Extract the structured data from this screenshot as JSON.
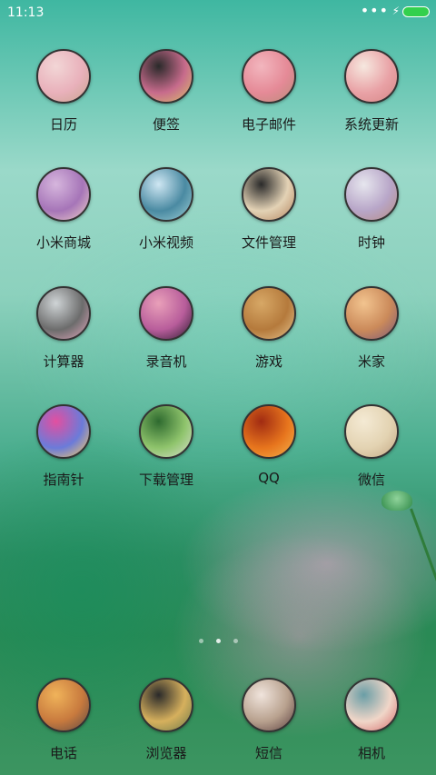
{
  "status_bar": {
    "time": "11:13",
    "dots": "•••",
    "charging_icon": "lightning-icon",
    "battery_color": "#33d04d"
  },
  "apps": [
    {
      "label": "日历",
      "icon": "calendar-icon",
      "colors": [
        "#f2d6d6",
        "#e9b1bb",
        "#c9a48f"
      ]
    },
    {
      "label": "便签",
      "icon": "notes-icon",
      "colors": [
        "#2a2a2a",
        "#c76b8c",
        "#d9c26a"
      ]
    },
    {
      "label": "电子邮件",
      "icon": "mail-icon",
      "colors": [
        "#f2b6be",
        "#e58a97",
        "#b98c7a"
      ]
    },
    {
      "label": "系统更新",
      "icon": "update-icon",
      "colors": [
        "#f6e8df",
        "#e9a2a6",
        "#d68686"
      ]
    },
    {
      "label": "小米商城",
      "icon": "mi-store-icon",
      "colors": [
        "#d6b6dd",
        "#a675b8",
        "#f1d1c8"
      ]
    },
    {
      "label": "小米视频",
      "icon": "mi-video-icon",
      "colors": [
        "#cfe7f3",
        "#4a8aa2",
        "#9fd0d6"
      ]
    },
    {
      "label": "文件管理",
      "icon": "file-manager-icon",
      "colors": [
        "#2a2a2a",
        "#e3d2b5",
        "#b3845e"
      ]
    },
    {
      "label": "时钟",
      "icon": "clock-icon",
      "colors": [
        "#e6e6ee",
        "#b8a6c8",
        "#b98d83"
      ]
    },
    {
      "label": "计算器",
      "icon": "calculator-icon",
      "colors": [
        "#cfd4d6",
        "#6c6c6c",
        "#e6a9c0"
      ]
    },
    {
      "label": "录音机",
      "icon": "recorder-icon",
      "colors": [
        "#e9a0b9",
        "#b85d9b",
        "#2b1b2f"
      ]
    },
    {
      "label": "游戏",
      "icon": "game-icon",
      "colors": [
        "#d7a866",
        "#b57a3c",
        "#e5c48e"
      ]
    },
    {
      "label": "米家",
      "icon": "mijia-icon",
      "colors": [
        "#f2c48f",
        "#cb8a5a",
        "#7c5a7a"
      ]
    },
    {
      "label": "指南针",
      "icon": "compass-icon",
      "colors": [
        "#e24fa0",
        "#6b7bd9",
        "#ffd05e"
      ]
    },
    {
      "label": "下载管理",
      "icon": "download-icon",
      "colors": [
        "#2e6a2f",
        "#8fc46c",
        "#d8dfcf"
      ]
    },
    {
      "label": "QQ",
      "icon": "qq-icon",
      "colors": [
        "#a12b12",
        "#e7751d",
        "#f6b34c"
      ]
    },
    {
      "label": "微信",
      "icon": "wechat-icon",
      "colors": [
        "#f4ead4",
        "#e3d3b2",
        "#c4a884"
      ]
    }
  ],
  "dock": [
    {
      "label": "电话",
      "icon": "phone-icon",
      "colors": [
        "#f0b35a",
        "#c87a3e",
        "#5d4a45"
      ]
    },
    {
      "label": "浏览器",
      "icon": "browser-icon",
      "colors": [
        "#2a2a2a",
        "#d6b05d",
        "#6c7a4a"
      ]
    },
    {
      "label": "短信",
      "icon": "sms-icon",
      "colors": [
        "#f0e4dc",
        "#b8a18e",
        "#5b3f40"
      ]
    },
    {
      "label": "相机",
      "icon": "camera-icon",
      "colors": [
        "#6a9ea6",
        "#f0d6c8",
        "#d46b6b"
      ]
    }
  ],
  "pager": {
    "pages": 3,
    "active": 2
  }
}
